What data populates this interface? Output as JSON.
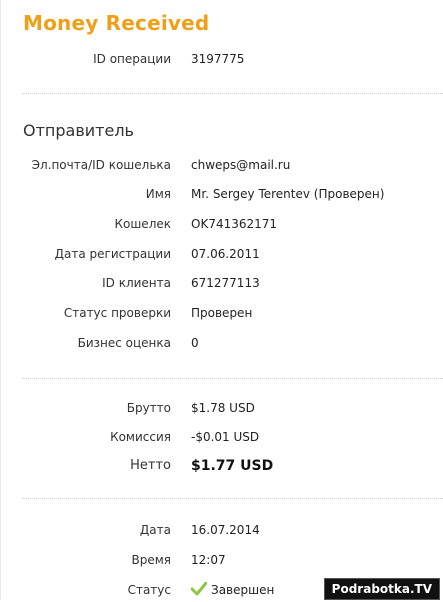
{
  "header": {
    "title": "Money Received"
  },
  "operation": {
    "id_label": "ID операции",
    "id_value": "3197775"
  },
  "sender": {
    "section_title": "Отправитель",
    "fields": [
      {
        "label": "Эл.почта/ID кошелька",
        "value": "chweps@mail.ru"
      },
      {
        "label": "Имя",
        "value": "Mr. Sergey Terentev (Проверен)"
      },
      {
        "label": "Кошелек",
        "value": "OK741362171"
      },
      {
        "label": "Дата регистрации",
        "value": "07.06.2011"
      },
      {
        "label": "ID клиента",
        "value": "671277113"
      },
      {
        "label": "Статус проверки",
        "value": "Проверен"
      },
      {
        "label": "Бизнес оценка",
        "value": "0"
      }
    ]
  },
  "amounts": {
    "gross_label": "Брутто",
    "gross_value": "$1.78 USD",
    "fee_label": "Комиссия",
    "fee_value": "-$0.01 USD",
    "net_label": "Нетто",
    "net_value": "$1.77 USD"
  },
  "details": {
    "date_label": "Дата",
    "date_value": "16.07.2014",
    "time_label": "Время",
    "time_value": "12:07",
    "status_label": "Статус",
    "status_value": "Завершен",
    "status_icon": "checkmark-icon",
    "accent_color": "#f0a018",
    "check_color": "#8cc63f"
  },
  "watermark": {
    "text": "Podrabotka.TV"
  }
}
